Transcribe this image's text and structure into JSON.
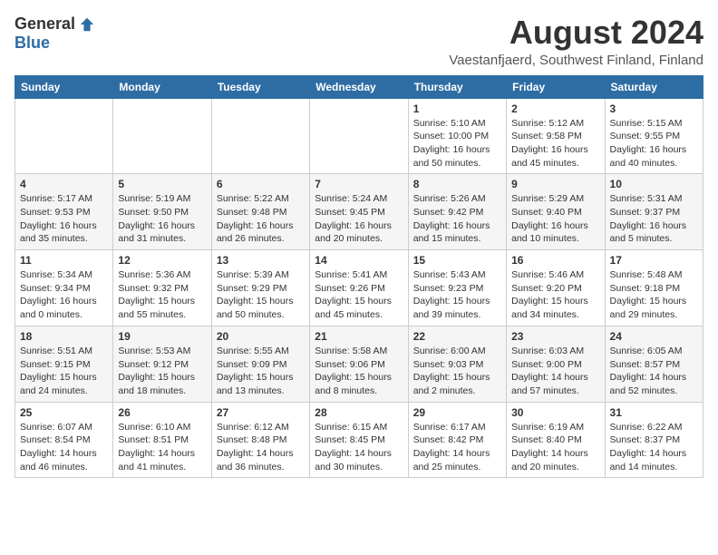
{
  "logo": {
    "general": "General",
    "blue": "Blue"
  },
  "title": {
    "month_year": "August 2024",
    "location": "Vaestanfjaerd, Southwest Finland, Finland"
  },
  "headers": [
    "Sunday",
    "Monday",
    "Tuesday",
    "Wednesday",
    "Thursday",
    "Friday",
    "Saturday"
  ],
  "weeks": [
    [
      {
        "day": "",
        "info": ""
      },
      {
        "day": "",
        "info": ""
      },
      {
        "day": "",
        "info": ""
      },
      {
        "day": "",
        "info": ""
      },
      {
        "day": "1",
        "info": "Sunrise: 5:10 AM\nSunset: 10:00 PM\nDaylight: 16 hours\nand 50 minutes."
      },
      {
        "day": "2",
        "info": "Sunrise: 5:12 AM\nSunset: 9:58 PM\nDaylight: 16 hours\nand 45 minutes."
      },
      {
        "day": "3",
        "info": "Sunrise: 5:15 AM\nSunset: 9:55 PM\nDaylight: 16 hours\nand 40 minutes."
      }
    ],
    [
      {
        "day": "4",
        "info": "Sunrise: 5:17 AM\nSunset: 9:53 PM\nDaylight: 16 hours\nand 35 minutes."
      },
      {
        "day": "5",
        "info": "Sunrise: 5:19 AM\nSunset: 9:50 PM\nDaylight: 16 hours\nand 31 minutes."
      },
      {
        "day": "6",
        "info": "Sunrise: 5:22 AM\nSunset: 9:48 PM\nDaylight: 16 hours\nand 26 minutes."
      },
      {
        "day": "7",
        "info": "Sunrise: 5:24 AM\nSunset: 9:45 PM\nDaylight: 16 hours\nand 20 minutes."
      },
      {
        "day": "8",
        "info": "Sunrise: 5:26 AM\nSunset: 9:42 PM\nDaylight: 16 hours\nand 15 minutes."
      },
      {
        "day": "9",
        "info": "Sunrise: 5:29 AM\nSunset: 9:40 PM\nDaylight: 16 hours\nand 10 minutes."
      },
      {
        "day": "10",
        "info": "Sunrise: 5:31 AM\nSunset: 9:37 PM\nDaylight: 16 hours\nand 5 minutes."
      }
    ],
    [
      {
        "day": "11",
        "info": "Sunrise: 5:34 AM\nSunset: 9:34 PM\nDaylight: 16 hours\nand 0 minutes."
      },
      {
        "day": "12",
        "info": "Sunrise: 5:36 AM\nSunset: 9:32 PM\nDaylight: 15 hours\nand 55 minutes."
      },
      {
        "day": "13",
        "info": "Sunrise: 5:39 AM\nSunset: 9:29 PM\nDaylight: 15 hours\nand 50 minutes."
      },
      {
        "day": "14",
        "info": "Sunrise: 5:41 AM\nSunset: 9:26 PM\nDaylight: 15 hours\nand 45 minutes."
      },
      {
        "day": "15",
        "info": "Sunrise: 5:43 AM\nSunset: 9:23 PM\nDaylight: 15 hours\nand 39 minutes."
      },
      {
        "day": "16",
        "info": "Sunrise: 5:46 AM\nSunset: 9:20 PM\nDaylight: 15 hours\nand 34 minutes."
      },
      {
        "day": "17",
        "info": "Sunrise: 5:48 AM\nSunset: 9:18 PM\nDaylight: 15 hours\nand 29 minutes."
      }
    ],
    [
      {
        "day": "18",
        "info": "Sunrise: 5:51 AM\nSunset: 9:15 PM\nDaylight: 15 hours\nand 24 minutes."
      },
      {
        "day": "19",
        "info": "Sunrise: 5:53 AM\nSunset: 9:12 PM\nDaylight: 15 hours\nand 18 minutes."
      },
      {
        "day": "20",
        "info": "Sunrise: 5:55 AM\nSunset: 9:09 PM\nDaylight: 15 hours\nand 13 minutes."
      },
      {
        "day": "21",
        "info": "Sunrise: 5:58 AM\nSunset: 9:06 PM\nDaylight: 15 hours\nand 8 minutes."
      },
      {
        "day": "22",
        "info": "Sunrise: 6:00 AM\nSunset: 9:03 PM\nDaylight: 15 hours\nand 2 minutes."
      },
      {
        "day": "23",
        "info": "Sunrise: 6:03 AM\nSunset: 9:00 PM\nDaylight: 14 hours\nand 57 minutes."
      },
      {
        "day": "24",
        "info": "Sunrise: 6:05 AM\nSunset: 8:57 PM\nDaylight: 14 hours\nand 52 minutes."
      }
    ],
    [
      {
        "day": "25",
        "info": "Sunrise: 6:07 AM\nSunset: 8:54 PM\nDaylight: 14 hours\nand 46 minutes."
      },
      {
        "day": "26",
        "info": "Sunrise: 6:10 AM\nSunset: 8:51 PM\nDaylight: 14 hours\nand 41 minutes."
      },
      {
        "day": "27",
        "info": "Sunrise: 6:12 AM\nSunset: 8:48 PM\nDaylight: 14 hours\nand 36 minutes."
      },
      {
        "day": "28",
        "info": "Sunrise: 6:15 AM\nSunset: 8:45 PM\nDaylight: 14 hours\nand 30 minutes."
      },
      {
        "day": "29",
        "info": "Sunrise: 6:17 AM\nSunset: 8:42 PM\nDaylight: 14 hours\nand 25 minutes."
      },
      {
        "day": "30",
        "info": "Sunrise: 6:19 AM\nSunset: 8:40 PM\nDaylight: 14 hours\nand 20 minutes."
      },
      {
        "day": "31",
        "info": "Sunrise: 6:22 AM\nSunset: 8:37 PM\nDaylight: 14 hours\nand 14 minutes."
      }
    ]
  ]
}
